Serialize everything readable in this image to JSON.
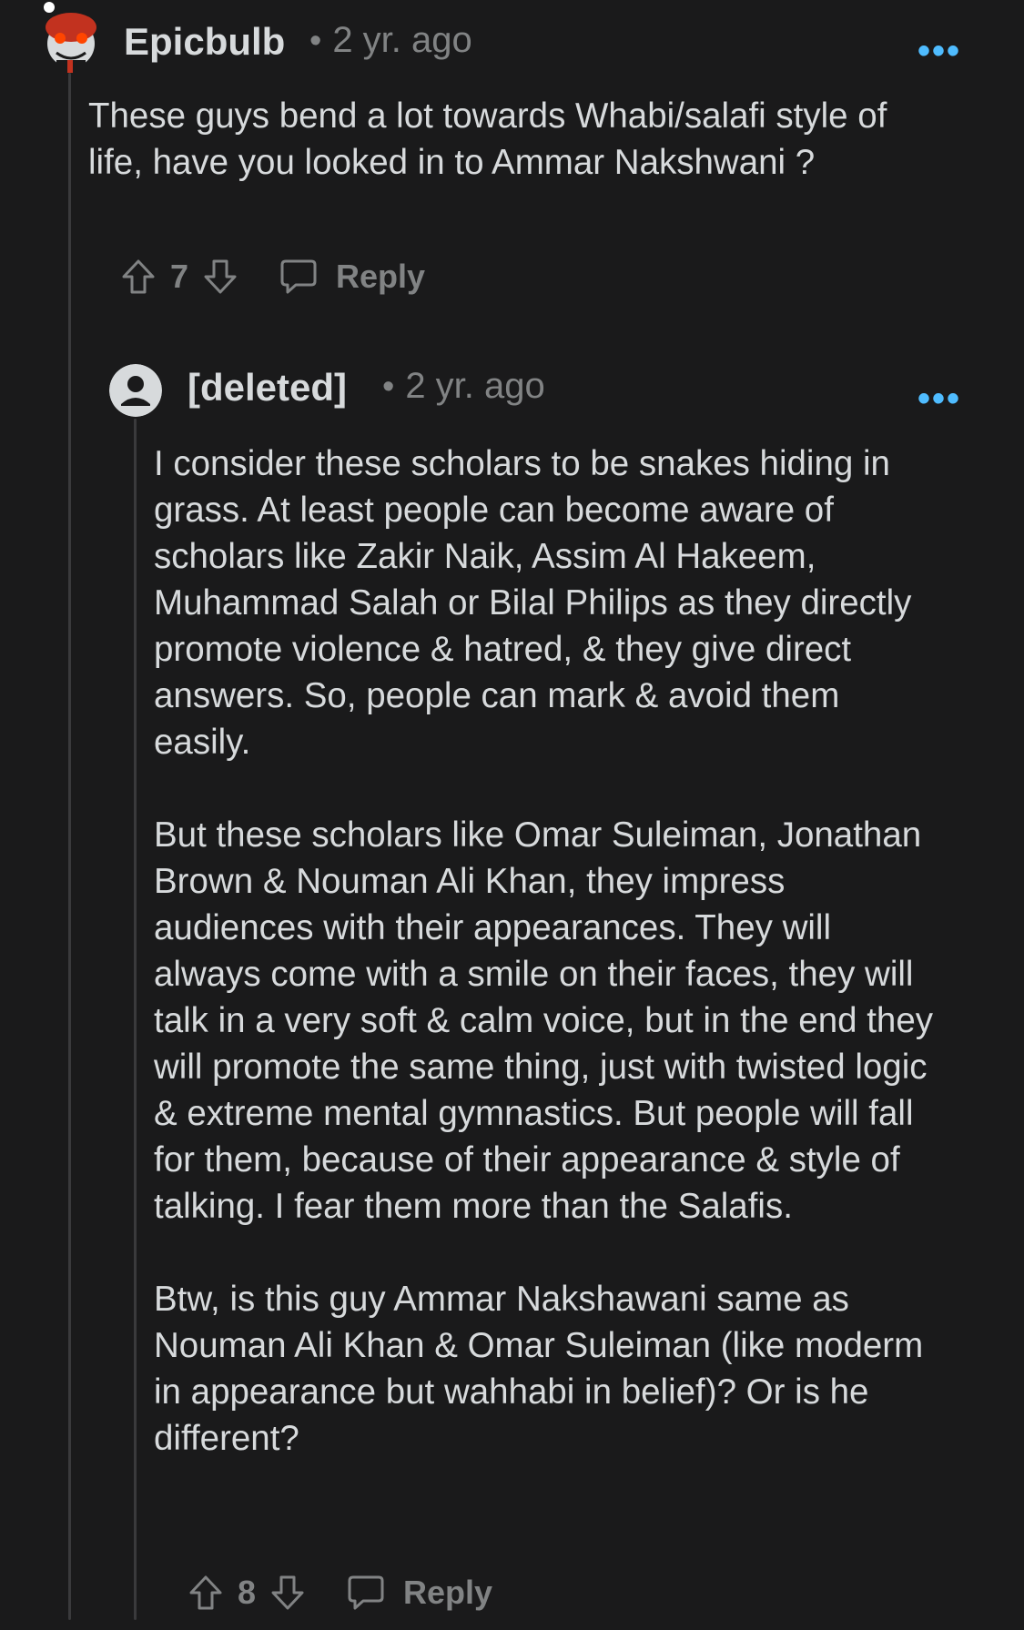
{
  "comments": [
    {
      "author": "Epicbulb",
      "time": "2 yr. ago",
      "dot": "•",
      "more_label": "•••",
      "avatar_icon": "snoo-avatar-icon",
      "paragraphs": [
        "These guys bend a lot towards Whabi/salafi style of life, have you looked in to Ammar Nakshwani ?"
      ],
      "votes": "7",
      "reply_label": "Reply"
    },
    {
      "author": "[deleted]",
      "time": "2 yr. ago",
      "dot": "•",
      "more_label": "•••",
      "avatar_icon": "deleted-user-icon",
      "paragraphs": [
        "I consider these scholars to be snakes hiding in grass. At least people can become aware of scholars like Zakir Naik, Assim Al Hakeem, Muhammad Salah or Bilal Philips as they directly promote violence & hatred, & they give direct answers. So, people can mark & avoid them easily.",
        "But these scholars like Omar Suleiman, Jonathan Brown & Nouman Ali Khan, they impress audiences with their appearances. They will always come with a smile on their faces, they will talk in a very soft & calm voice, but in the end they will promote the same thing, just with twisted logic & extreme mental gymnastics. But people will fall for them, because of their appearance & style of talking. I fear them more than the Salafis.",
        "Btw, is this guy Ammar Nakshawani same as Nouman Ali Khan & Omar Suleiman (like moderm in appearance but wahhabi in belief)? Or is he different?"
      ],
      "votes": "8",
      "reply_label": "Reply"
    }
  ],
  "colors": {
    "background": "#1a1a1b",
    "text": "#d7dadc",
    "muted": "#818384",
    "accent": "#4fbcff",
    "thread_line": "#3a3a3c"
  }
}
